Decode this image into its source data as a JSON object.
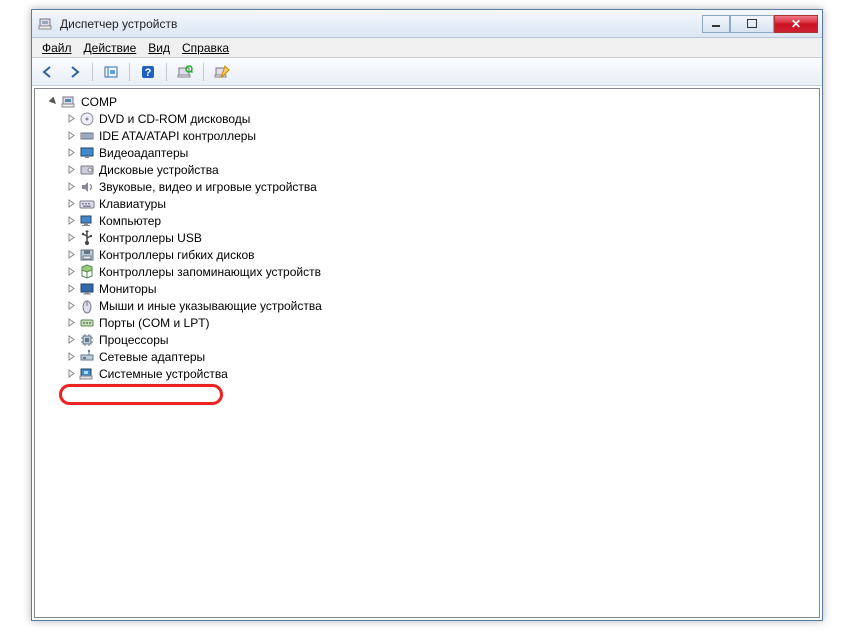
{
  "title": "Диспетчер устройств",
  "menu": {
    "file": "Файл",
    "action": "Действие",
    "view": "Вид",
    "help": "Справка"
  },
  "toolbar": {
    "back": "Назад",
    "forward": "Вперёд",
    "show_hidden": "Показать скрытые",
    "help": "Справка",
    "scan": "Обновить",
    "properties": "Свойства"
  },
  "tree": {
    "root": "COMP",
    "items": [
      {
        "label": "DVD и CD-ROM дисководы",
        "icon": "optical"
      },
      {
        "label": "IDE ATA/ATAPI контроллеры",
        "icon": "ide"
      },
      {
        "label": "Видеоадаптеры",
        "icon": "display"
      },
      {
        "label": "Дисковые устройства",
        "icon": "disk"
      },
      {
        "label": "Звуковые, видео и игровые устройства",
        "icon": "sound"
      },
      {
        "label": "Клавиатуры",
        "icon": "keyboard"
      },
      {
        "label": "Компьютер",
        "icon": "computer"
      },
      {
        "label": "Контроллеры USB",
        "icon": "usb"
      },
      {
        "label": "Контроллеры гибких дисков",
        "icon": "floppyctrl"
      },
      {
        "label": "Контроллеры запоминающих устройств",
        "icon": "storage"
      },
      {
        "label": "Мониторы",
        "icon": "monitor"
      },
      {
        "label": "Мыши и иные указывающие устройства",
        "icon": "mouse"
      },
      {
        "label": "Порты (COM и LPT)",
        "icon": "port"
      },
      {
        "label": "Процессоры",
        "icon": "cpu"
      },
      {
        "label": "Сетевые адаптеры",
        "icon": "network",
        "highlight": true
      },
      {
        "label": "Системные устройства",
        "icon": "system"
      }
    ]
  }
}
